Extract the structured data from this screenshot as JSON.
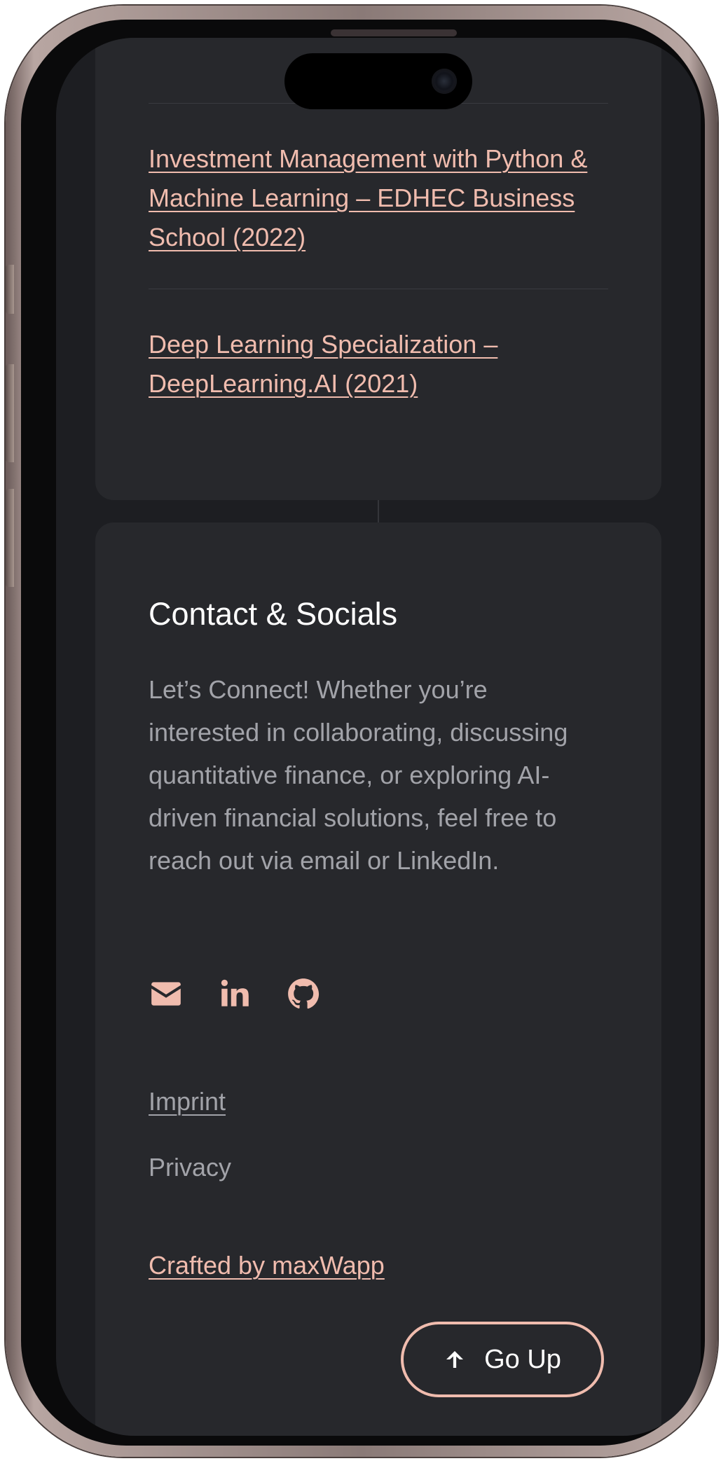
{
  "certifications": [
    {
      "label": "Investment Management with Python & Machine Learning – EDHEC Business School (2022)"
    },
    {
      "label": "Deep Learning Specialization – DeepLearning.AI (2021)"
    }
  ],
  "contact": {
    "title": "Contact & Socials",
    "intro": "Let’s Connect! Whether you’re interested in collaborating, discussing quantitative finance, or exploring AI-driven financial solutions, feel free to reach out via email or LinkedIn.",
    "socials": [
      {
        "icon": "envelope-icon",
        "label": "Email"
      },
      {
        "icon": "linkedin-icon",
        "label": "LinkedIn"
      },
      {
        "icon": "github-icon",
        "label": "GitHub"
      }
    ]
  },
  "footer": {
    "imprint": "Imprint",
    "privacy": "Privacy",
    "crafted_by": "Crafted by maxWapp",
    "go_up": "Go Up"
  },
  "colors": {
    "background": "#1d1e22",
    "card": "#27282c",
    "accent": "#f0bcae",
    "muted_text": "#a2a3a9",
    "heading": "#ffffff"
  }
}
